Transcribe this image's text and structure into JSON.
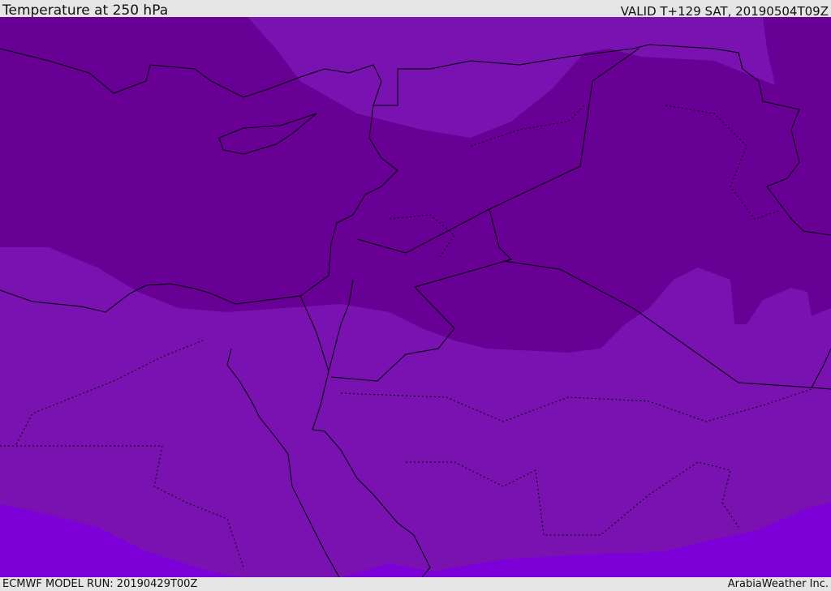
{
  "header": {
    "title": "Temperature at 250 hPa",
    "valid": "VALID T+129 SAT, 20190504T09Z"
  },
  "footer": {
    "model_run": "ECMWF MODEL RUN: 20190429T00Z",
    "credit": "ArabiaWeather Inc."
  },
  "colors": {
    "cold_band": "#680096",
    "mid_band": "#7912b0",
    "warm_band": "#7e00d8",
    "border": "#000000"
  }
}
